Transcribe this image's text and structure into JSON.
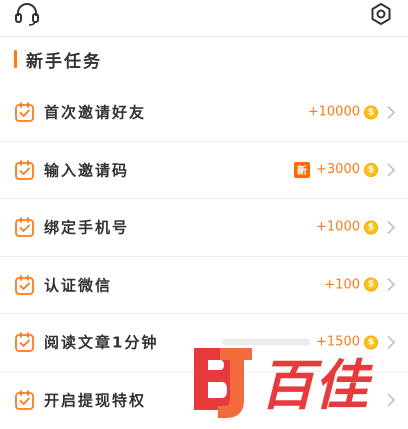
{
  "header": {
    "left_icon": "headset-icon",
    "right_icon": "settings-icon"
  },
  "section": {
    "title": "新手任务"
  },
  "tasks": [
    {
      "label": "首次邀请好友",
      "reward": "+10000",
      "badge": "",
      "icon": "task-check-icon"
    },
    {
      "label": "输入邀请码",
      "reward": "+3000",
      "badge": "新",
      "icon": "task-check-icon"
    },
    {
      "label": "绑定手机号",
      "reward": "+1000",
      "badge": "",
      "icon": "task-check-icon"
    },
    {
      "label": "认证微信",
      "reward": "+100",
      "badge": "",
      "icon": "task-check-icon"
    },
    {
      "label": "阅读文章1分钟",
      "reward": "+1500",
      "badge": "",
      "icon": "task-check-icon"
    },
    {
      "label": "开启提现特权",
      "reward": "",
      "badge": "",
      "icon": "task-check-icon"
    }
  ],
  "coin_symbol": "$",
  "watermark": {
    "text": "百佳"
  },
  "colors": {
    "accent": "#ff7a1a",
    "coin": "#ffc21a",
    "badge": "#ff6a00",
    "watermark": "#e8393c"
  }
}
